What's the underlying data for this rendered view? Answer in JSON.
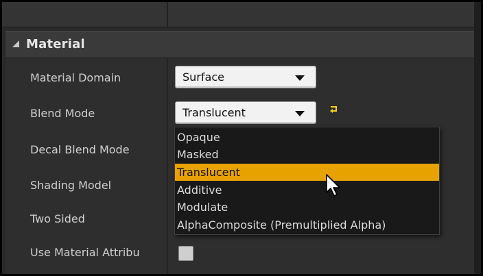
{
  "section": {
    "title": "Material"
  },
  "properties": {
    "material_domain": {
      "label": "Material Domain",
      "value": "Surface"
    },
    "blend_mode": {
      "label": "Blend Mode",
      "value": "Translucent"
    },
    "decal_blend_mode": {
      "label": "Decal Blend Mode"
    },
    "shading_model": {
      "label": "Shading Model"
    },
    "two_sided": {
      "label": "Two Sided"
    },
    "use_material_attributes": {
      "label": "Use Material Attribu"
    }
  },
  "blend_mode_dropdown": {
    "options": [
      "Opaque",
      "Masked",
      "Translucent",
      "Additive",
      "Modulate",
      "AlphaComposite (Premultiplied Alpha)"
    ],
    "selected": "Translucent"
  },
  "colors": {
    "highlight": "#e7a200",
    "reset_arrow": "#f2d21a",
    "panel_bg": "#2e2e2e",
    "header_bg": "#3a3a3a"
  },
  "icons": {
    "section_collapse": "triangle-expanded-icon",
    "reset_to_default": "reset-arrow-icon",
    "pointer": "mouse-cursor-icon"
  }
}
